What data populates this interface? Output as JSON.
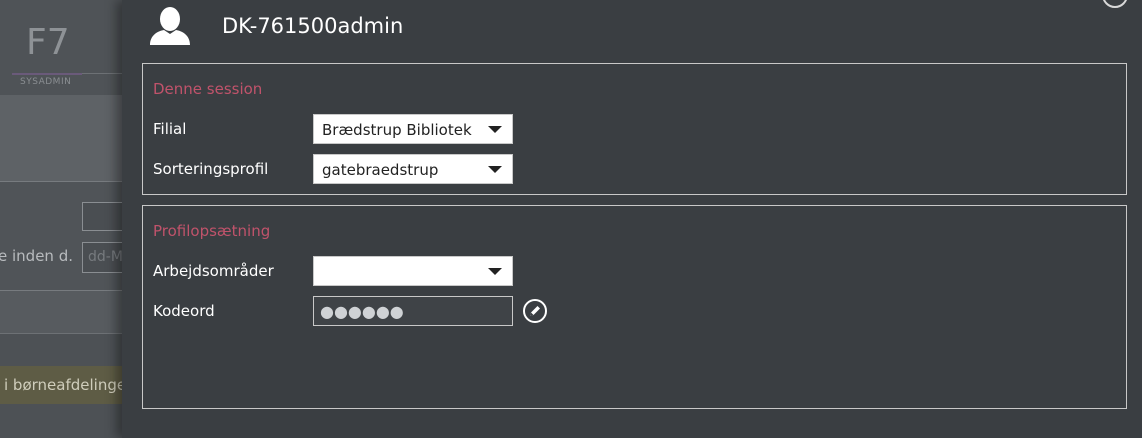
{
  "background_app": {
    "logo_text": "F7",
    "logo_subtitle": "SYSADMIN",
    "partial_label": "e inden d.",
    "partial_input_placeholder": "dd-M",
    "partial_banner": "i børneafdelinge"
  },
  "user": {
    "name": "DK-761500admin",
    "avatar_icon": "user-silhouette-icon"
  },
  "session_section": {
    "title": "Denne session",
    "branch_label": "Filial",
    "branch_value": "Brædstrup Bibliotek",
    "sorting_label": "Sorteringsprofil",
    "sorting_value": "gatebraedstrup"
  },
  "profile_section": {
    "title": "Profilopsætning",
    "workareas_label": "Arbejdsområder",
    "workareas_value": "",
    "password_label": "Kodeord",
    "password_value": "●●●●●●",
    "edit_icon": "pencil-icon"
  },
  "colors": {
    "section_title": "#c0536b",
    "panel_bg": "#3a3e42",
    "border": "#c8c8c8"
  }
}
